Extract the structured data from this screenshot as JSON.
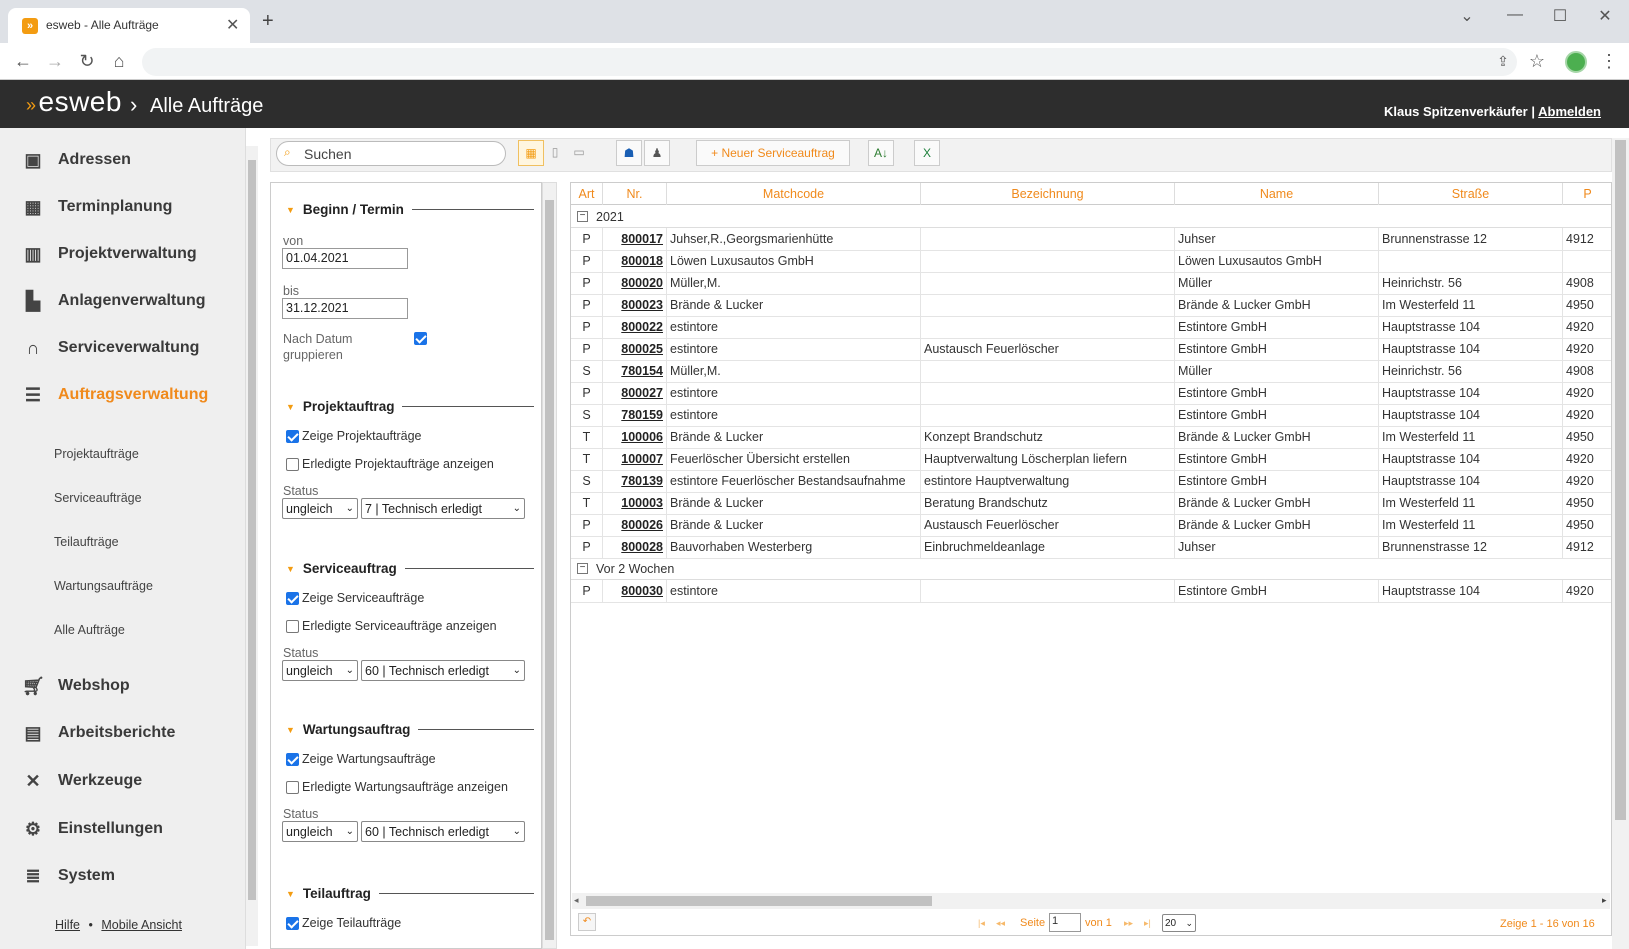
{
  "browser": {
    "tab_title": "esweb - Alle Aufträge",
    "tab_close": "✕",
    "new_tab": "+"
  },
  "app": {
    "logo": "esweb",
    "crumb_sep": "›",
    "page_title": "Alle Aufträge",
    "user_name": "Klaus Spitzenverkäufer",
    "user_sep": "|",
    "logout": "Abmelden"
  },
  "sidebar": {
    "items": [
      {
        "label": "Adressen",
        "icon": "address-card-icon"
      },
      {
        "label": "Terminplanung",
        "icon": "calendar-icon"
      },
      {
        "label": "Projektverwaltung",
        "icon": "project-grid-icon"
      },
      {
        "label": "Anlagenverwaltung",
        "icon": "factory-icon"
      },
      {
        "label": "Serviceverwaltung",
        "icon": "headset-icon"
      },
      {
        "label": "Auftragsverwaltung",
        "icon": "list-icon"
      },
      {
        "label": "Webshop",
        "icon": "cart-icon"
      },
      {
        "label": "Arbeitsberichte",
        "icon": "clipboard-icon"
      },
      {
        "label": "Werkzeuge",
        "icon": "tools-icon"
      },
      {
        "label": "Einstellungen",
        "icon": "gears-icon"
      },
      {
        "label": "System",
        "icon": "database-icon"
      }
    ],
    "subitems": [
      "Projektaufträge",
      "Serviceaufträge",
      "Teilaufträge",
      "Wartungsaufträge",
      "Alle Aufträge"
    ],
    "footer_help": "Hilfe",
    "footer_sep": "•",
    "footer_mobile": "Mobile Ansicht"
  },
  "toolbar": {
    "search_placeholder": "Suchen",
    "new_service_order": "Neuer Serviceauftrag"
  },
  "filter": {
    "beginn_title": "Beginn / Termin",
    "von_label": "von",
    "von_value": "01.04.2021",
    "bis_label": "bis",
    "bis_value": "31.12.2021",
    "group_label_1": "Nach Datum",
    "group_label_2": "gruppieren",
    "projekt_title": "Projektauftrag",
    "projekt_show": "Zeige Projektaufträge",
    "projekt_done": "Erledigte Projektaufträge anzeigen",
    "projekt_status_label": "Status",
    "projekt_op": "ungleich",
    "projekt_status": "7 | Technisch erledigt",
    "service_title": "Serviceauftrag",
    "service_show": "Zeige Serviceaufträge",
    "service_done": "Erledigte Serviceaufträge anzeigen",
    "service_status_label": "Status",
    "service_op": "ungleich",
    "service_status": "60 | Technisch erledigt",
    "wartung_title": "Wartungsauftrag",
    "wartung_show": "Zeige Wartungsaufträge",
    "wartung_done": "Erledigte Wartungsaufträge anzeigen",
    "wartung_status_label": "Status",
    "wartung_op": "ungleich",
    "wartung_status": "60 | Technisch erledigt",
    "teil_title": "Teilauftrag",
    "teil_show": "Zeige Teilaufträge"
  },
  "grid": {
    "columns": [
      "Art",
      "Nr.",
      "Matchcode",
      "Bezeichnung",
      "Name",
      "Straße",
      "P"
    ],
    "groups": [
      {
        "label": "2021",
        "rows": [
          [
            "P",
            "800017",
            "Juhser,R.,Georgsmarienhütte",
            "",
            "Juhser",
            "Brunnenstrasse 12",
            "4912"
          ],
          [
            "P",
            "800018",
            "Löwen Luxusautos GmbH",
            "",
            "Löwen Luxusautos GmbH",
            "",
            ""
          ],
          [
            "P",
            "800020",
            "Müller,M.",
            "",
            "Müller",
            "Heinrichstr. 56",
            "4908"
          ],
          [
            "P",
            "800023",
            "Brände & Lucker",
            "",
            "Brände & Lucker GmbH",
            "Im Westerfeld 11",
            "4950"
          ],
          [
            "P",
            "800022",
            "estintore",
            "",
            "Estintore GmbH",
            "Hauptstrasse 104",
            "4920"
          ],
          [
            "P",
            "800025",
            "estintore",
            "Austausch Feuerlöscher",
            "Estintore GmbH",
            "Hauptstrasse 104",
            "4920"
          ],
          [
            "S",
            "780154",
            "Müller,M.",
            "",
            "Müller",
            "Heinrichstr. 56",
            "4908"
          ],
          [
            "P",
            "800027",
            "estintore",
            "",
            "Estintore GmbH",
            "Hauptstrasse 104",
            "4920"
          ],
          [
            "S",
            "780159",
            "estintore",
            "",
            "Estintore GmbH",
            "Hauptstrasse 104",
            "4920"
          ],
          [
            "T",
            "100006",
            "Brände & Lucker",
            "Konzept Brandschutz",
            "Brände & Lucker GmbH",
            "Im Westerfeld 11",
            "4950"
          ],
          [
            "T",
            "100007",
            "Feuerlöscher Übersicht erstellen",
            "Hauptverwaltung Löscherplan liefern",
            "Estintore GmbH",
            "Hauptstrasse 104",
            "4920"
          ],
          [
            "S",
            "780139",
            "estintore Feuerlöscher Bestandsaufnahme",
            "estintore Hauptverwaltung",
            "Estintore GmbH",
            "Hauptstrasse 104",
            "4920"
          ],
          [
            "T",
            "100003",
            "Brände & Lucker",
            "Beratung Brandschutz",
            "Brände & Lucker GmbH",
            "Im Westerfeld 11",
            "4950"
          ],
          [
            "P",
            "800026",
            "Brände & Lucker",
            "Austausch Feuerlöscher",
            "Brände & Lucker GmbH",
            "Im Westerfeld 11",
            "4950"
          ],
          [
            "P",
            "800028",
            "Bauvorhaben Westerberg",
            "Einbruchmeldeanlage",
            "Juhser",
            "Brunnenstrasse 12",
            "4912"
          ]
        ]
      },
      {
        "label": "Vor 2 Wochen",
        "rows": [
          [
            "P",
            "800030",
            "estintore",
            "",
            "Estintore GmbH",
            "Hauptstrasse 104",
            "4920"
          ]
        ]
      }
    ],
    "group_toggle": "−"
  },
  "pager": {
    "page_label": "Seite",
    "page_value": "1",
    "of_label": "von 1",
    "page_size": "20",
    "summary": "Zeige 1 - 16 von 16",
    "first": "|◂",
    "prev": "◂◂",
    "next": "▸▸",
    "last": "▸|",
    "back": "↶"
  }
}
